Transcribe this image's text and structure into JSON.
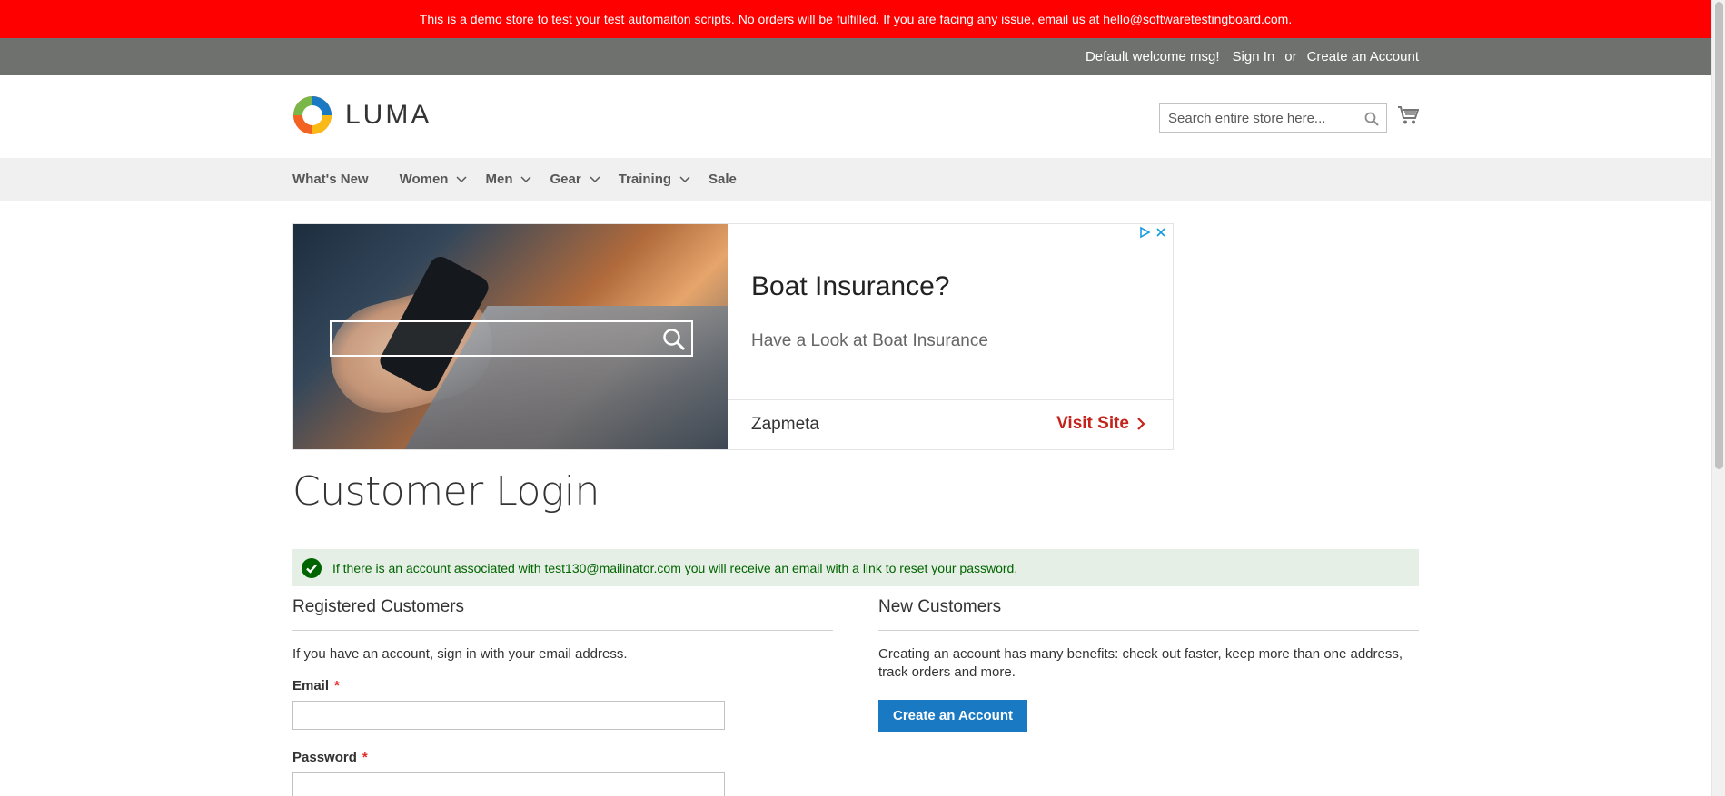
{
  "demo_notice": "This is a demo store to test your test automaiton scripts. No orders will be fulfilled. If you are facing any issue, email us at hello@softwaretestingboard.com.",
  "panel": {
    "welcome": "Default welcome msg!",
    "sign_in": "Sign In",
    "or": "or",
    "create_account": "Create an Account"
  },
  "header": {
    "logo_text": "LUMA",
    "search_placeholder": "Search entire store here...",
    "search_value": ""
  },
  "nav": {
    "items": [
      {
        "label": "What's New"
      },
      {
        "label": "Women"
      },
      {
        "label": "Men"
      },
      {
        "label": "Gear"
      },
      {
        "label": "Training"
      },
      {
        "label": "Sale"
      }
    ]
  },
  "ad": {
    "title": "Boat Insurance?",
    "description": "Have a Look at Boat Insurance",
    "brand": "Zapmeta",
    "cta": "Visit Site"
  },
  "page_title": "Customer Login",
  "message": {
    "success": "If there is an account associated with test130@mailinator.com you will receive an email with a link to reset your password."
  },
  "registered": {
    "title": "Registered Customers",
    "intro": "If you have an account, sign in with your email address.",
    "email_label": "Email",
    "password_label": "Password",
    "required_mark": "*",
    "email_value": "",
    "password_value": ""
  },
  "new_customers": {
    "title": "New Customers",
    "text": "Creating an account has many benefits: check out faster, keep more than one address, track orders and more.",
    "button": "Create an Account"
  },
  "colors": {
    "demo_bar": "#ff0000",
    "panel": "#6e716e",
    "nav": "#f0f0f0",
    "primary": "#1979c3",
    "success_bg": "#e5efe5",
    "success_text": "#006400",
    "ad_cta": "#c4221b"
  },
  "icons": {
    "logo": "luma-logo-icon",
    "search": "search-icon",
    "cart": "cart-icon",
    "chevron": "chevron-down-icon",
    "success": "check-circle-icon",
    "ad_choices": "adchoices-icon",
    "ad_close": "close-icon"
  }
}
